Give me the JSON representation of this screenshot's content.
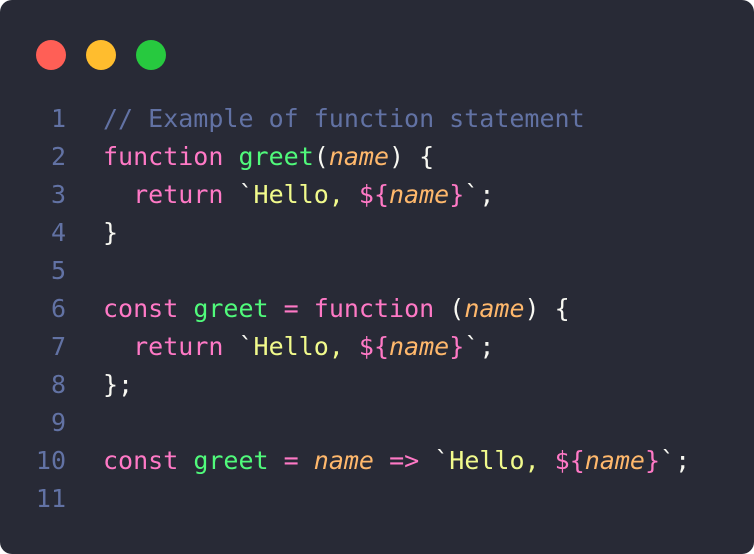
{
  "window": {
    "traffic_lights": [
      {
        "name": "close",
        "color": "#ff5f56"
      },
      {
        "name": "minimize",
        "color": "#ffbd2e"
      },
      {
        "name": "maximize",
        "color": "#27c93f"
      }
    ]
  },
  "colors": {
    "background": "#282a36",
    "foreground": "#f8f8f2",
    "comment": "#6272a4",
    "keyword": "#ff79c6",
    "function": "#50fa7b",
    "param": "#ffb86c",
    "string": "#f1fa8c",
    "line_number": "#6272a4"
  },
  "code": {
    "language": "javascript",
    "lines": [
      {
        "number": "1",
        "tokens": [
          {
            "text": "// Example of function statement",
            "type": "comment"
          }
        ]
      },
      {
        "number": "2",
        "tokens": [
          {
            "text": "function",
            "type": "keyword"
          },
          {
            "text": " ",
            "type": "plain"
          },
          {
            "text": "greet",
            "type": "function"
          },
          {
            "text": "(",
            "type": "plain"
          },
          {
            "text": "name",
            "type": "param"
          },
          {
            "text": ") {",
            "type": "plain"
          }
        ]
      },
      {
        "number": "3",
        "tokens": [
          {
            "text": "  ",
            "type": "plain"
          },
          {
            "text": "return",
            "type": "keyword"
          },
          {
            "text": " `",
            "type": "plain"
          },
          {
            "text": "Hello, ",
            "type": "string"
          },
          {
            "text": "${",
            "type": "keyword"
          },
          {
            "text": "name",
            "type": "param"
          },
          {
            "text": "}",
            "type": "keyword"
          },
          {
            "text": "`;",
            "type": "plain"
          }
        ]
      },
      {
        "number": "4",
        "tokens": [
          {
            "text": "}",
            "type": "plain"
          }
        ]
      },
      {
        "number": "5",
        "tokens": []
      },
      {
        "number": "6",
        "tokens": [
          {
            "text": "const",
            "type": "keyword"
          },
          {
            "text": " ",
            "type": "plain"
          },
          {
            "text": "greet",
            "type": "function"
          },
          {
            "text": " ",
            "type": "plain"
          },
          {
            "text": "=",
            "type": "keyword"
          },
          {
            "text": " ",
            "type": "plain"
          },
          {
            "text": "function",
            "type": "keyword"
          },
          {
            "text": " (",
            "type": "plain"
          },
          {
            "text": "name",
            "type": "param"
          },
          {
            "text": ") {",
            "type": "plain"
          }
        ]
      },
      {
        "number": "7",
        "tokens": [
          {
            "text": "  ",
            "type": "plain"
          },
          {
            "text": "return",
            "type": "keyword"
          },
          {
            "text": " `",
            "type": "plain"
          },
          {
            "text": "Hello, ",
            "type": "string"
          },
          {
            "text": "${",
            "type": "keyword"
          },
          {
            "text": "name",
            "type": "param"
          },
          {
            "text": "}",
            "type": "keyword"
          },
          {
            "text": "`;",
            "type": "plain"
          }
        ]
      },
      {
        "number": "8",
        "tokens": [
          {
            "text": "};",
            "type": "plain"
          }
        ]
      },
      {
        "number": "9",
        "tokens": []
      },
      {
        "number": "10",
        "tokens": [
          {
            "text": "const",
            "type": "keyword"
          },
          {
            "text": " ",
            "type": "plain"
          },
          {
            "text": "greet",
            "type": "function"
          },
          {
            "text": " ",
            "type": "plain"
          },
          {
            "text": "=",
            "type": "keyword"
          },
          {
            "text": " ",
            "type": "plain"
          },
          {
            "text": "name",
            "type": "param"
          },
          {
            "text": " ",
            "type": "plain"
          },
          {
            "text": "=>",
            "type": "keyword"
          },
          {
            "text": " `",
            "type": "plain"
          },
          {
            "text": "Hello, ",
            "type": "string"
          },
          {
            "text": "${",
            "type": "keyword"
          },
          {
            "text": "name",
            "type": "param"
          },
          {
            "text": "}",
            "type": "keyword"
          },
          {
            "text": "`;",
            "type": "plain"
          }
        ]
      },
      {
        "number": "11",
        "tokens": []
      }
    ]
  }
}
